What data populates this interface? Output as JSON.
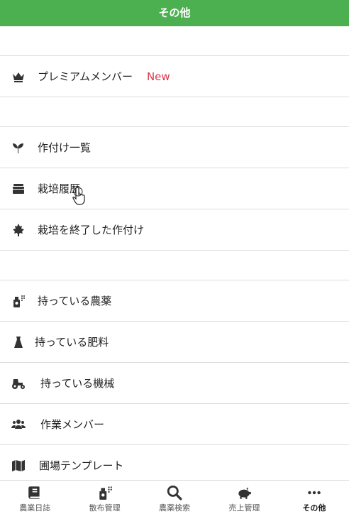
{
  "header": {
    "title": "その他"
  },
  "menu": {
    "premium": {
      "label": "プレミアムメンバー",
      "badge": "New"
    },
    "crops": "作付け一覧",
    "history": "栽培履歴",
    "finished": "栽培を終了した作付け",
    "pesticides": "持っている農薬",
    "fertilizers": "持っている肥料",
    "machinery": "持っている機械",
    "members": "作業メンバー",
    "field_template": "圃場テンプレート"
  },
  "tabs": [
    {
      "label": "農業日誌",
      "icon": "book-icon"
    },
    {
      "label": "散布管理",
      "icon": "spray-icon"
    },
    {
      "label": "農薬検索",
      "icon": "search-icon"
    },
    {
      "label": "売上管理",
      "icon": "piggy-bank-icon"
    },
    {
      "label": "その他",
      "icon": "more-icon"
    }
  ],
  "colors": {
    "header": "#4caf50",
    "badge": "#d9374b"
  }
}
